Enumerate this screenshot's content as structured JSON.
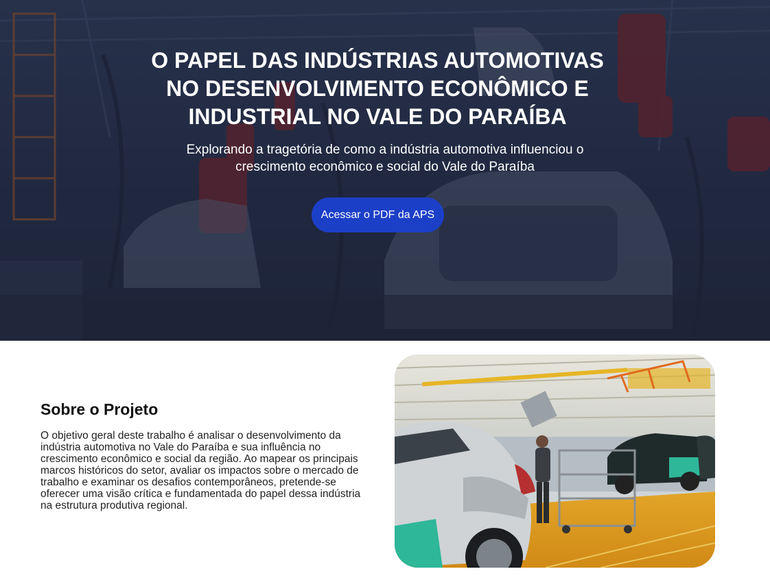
{
  "hero": {
    "title": "O PAPEL DAS INDÚSTRIAS AUTOMOTIVAS NO DESENVOLVIMENTO ECONÔMICO E INDUSTRIAL NO VALE DO PARAÍBA",
    "subtitle": "Explorando a tragetória de como a indústria automotiva influenciou o crescimento econômico e social do Vale do Paraíba",
    "button_label": "Acessar o PDF da APS",
    "background_image": "factory-robot-assembly-line-photo",
    "button_color": "#1c3fc8"
  },
  "about": {
    "title": "Sobre o Projeto",
    "text": "O objetivo geral deste trabalho é analisar o desenvolvimento da indústria automotiva no Vale do Paraíba e sua influência no crescimento econômico e social da região. Ao mapear os principais marcos históricos do setor, avaliar os impactos sobre o mercado de trabalho e examinar os desafios contemporâneos, pretende-se oferecer uma visão crítica e fundamentada do papel dessa indústria na estrutura produtiva regional.",
    "image": "car-assembly-line-worker-photo"
  }
}
